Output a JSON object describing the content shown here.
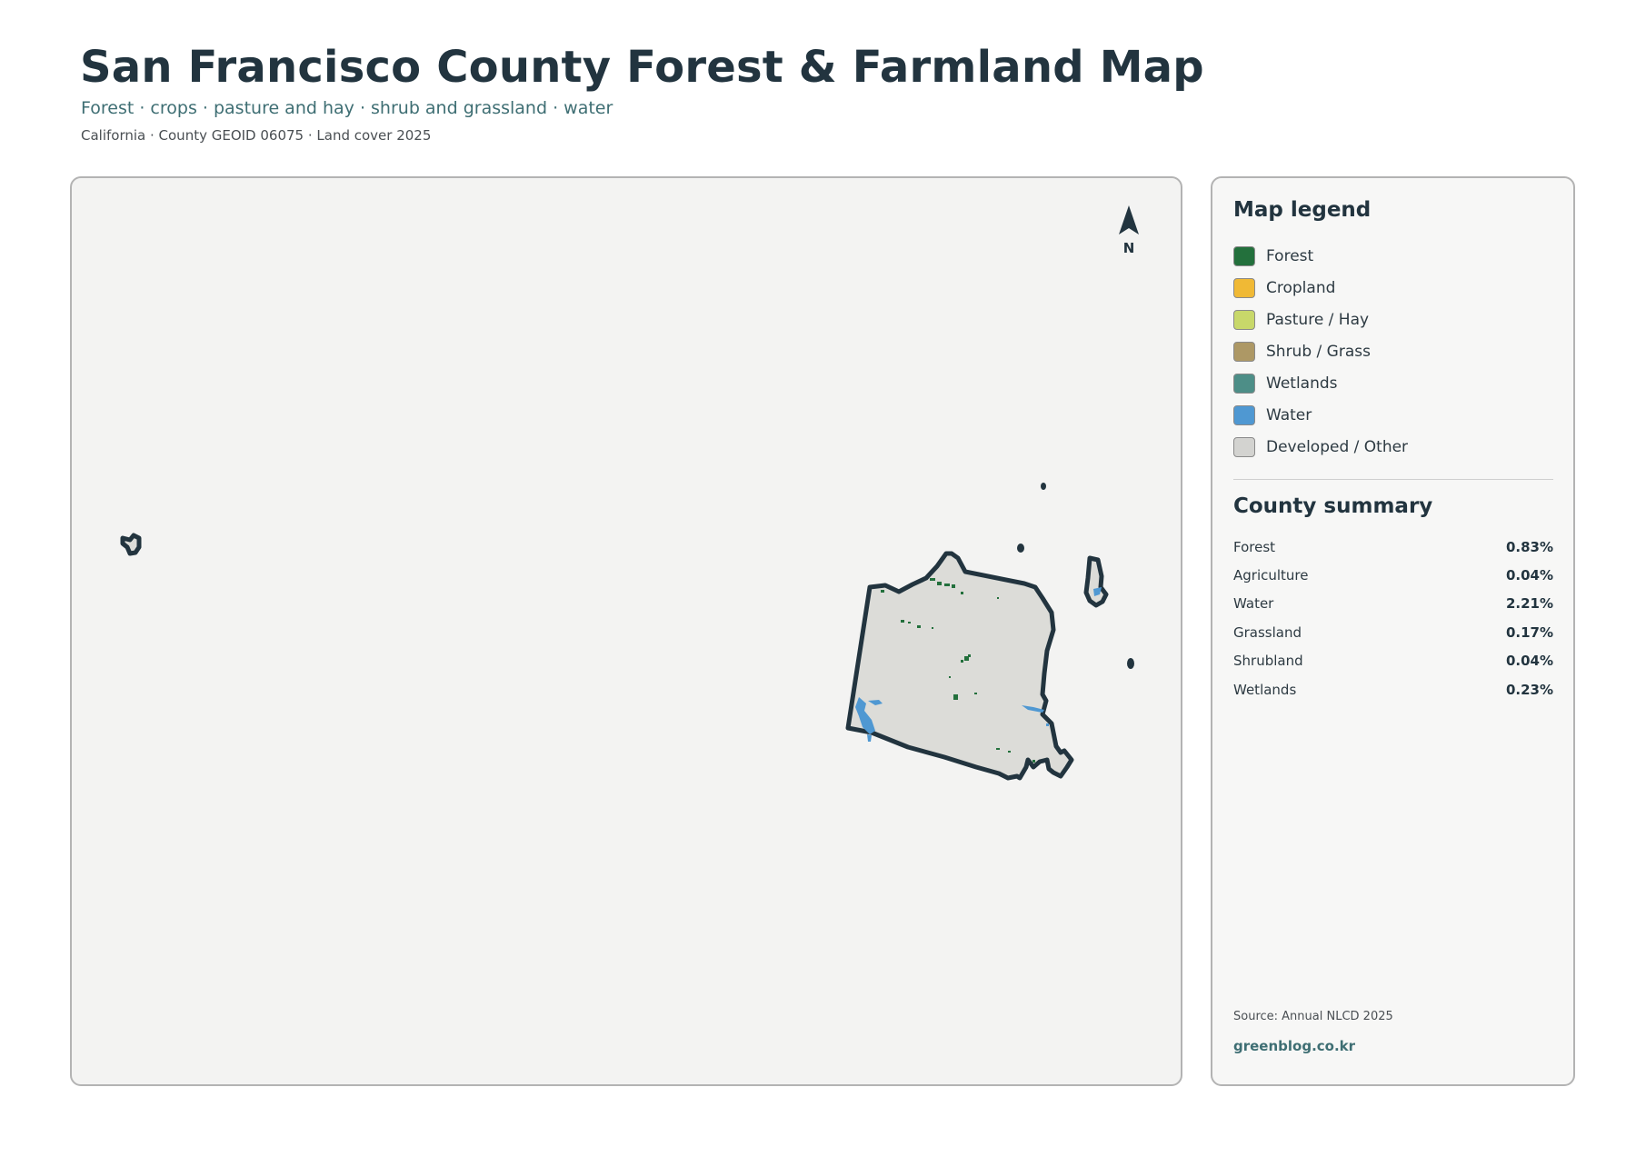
{
  "header": {
    "title": "San Francisco County Forest & Farmland Map",
    "subtitle": "Forest · crops · pasture and hay · shrub and grassland · water",
    "meta": "California · County GEOID 06075 · Land cover 2025"
  },
  "map": {
    "north_label": "N",
    "colors": {
      "background": "#f3f3f2",
      "developed": "#dcdcd8",
      "outline": "#22343f",
      "forest": "#23703c",
      "water": "#4f98d2"
    }
  },
  "legend": {
    "title": "Map legend",
    "items": [
      {
        "label": "Forest",
        "color": "#23703c"
      },
      {
        "label": "Cropland",
        "color": "#f0b935"
      },
      {
        "label": "Pasture / Hay",
        "color": "#c8d86a"
      },
      {
        "label": "Shrub / Grass",
        "color": "#ad9865"
      },
      {
        "label": "Wetlands",
        "color": "#4d8e87"
      },
      {
        "label": "Water",
        "color": "#4f98d2"
      },
      {
        "label": "Developed / Other",
        "color": "#d3d3d0"
      }
    ]
  },
  "summary": {
    "title": "County summary",
    "rows": [
      {
        "name": "Forest",
        "value": "0.83%"
      },
      {
        "name": "Agriculture",
        "value": "0.04%"
      },
      {
        "name": "Water",
        "value": "2.21%"
      },
      {
        "name": "Grassland",
        "value": "0.17%"
      },
      {
        "name": "Shrubland",
        "value": "0.04%"
      },
      {
        "name": "Wetlands",
        "value": "0.23%"
      }
    ]
  },
  "footer": {
    "source": "Source: Annual NLCD 2025",
    "site": "greenblog.co.kr"
  }
}
